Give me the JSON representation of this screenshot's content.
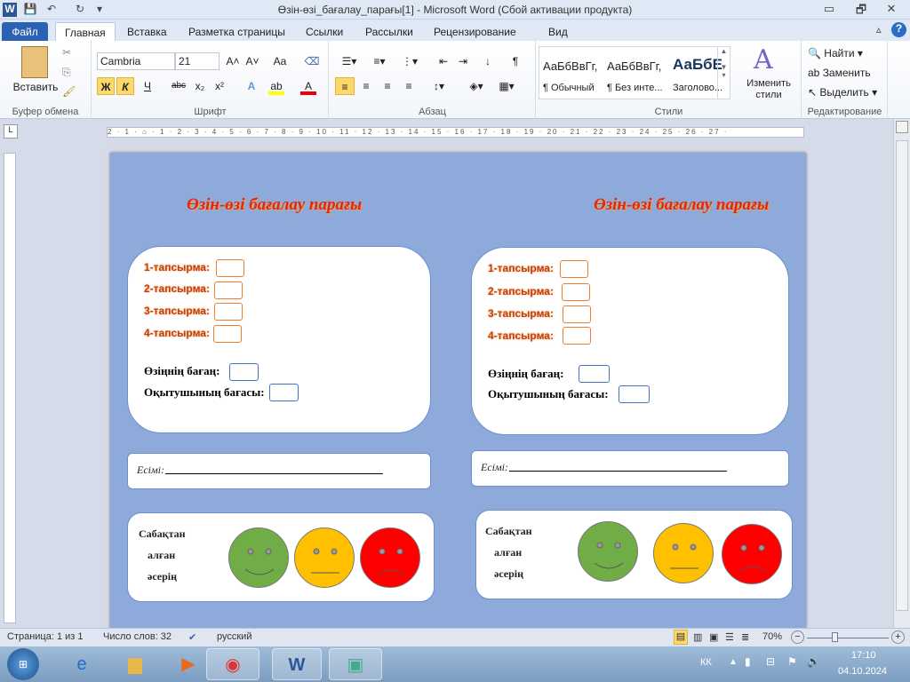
{
  "window": {
    "title": "Өзін-өзі_бағалау_парағы[1] - Microsoft Word (Сбой активации продукта)",
    "minimize": "▭",
    "restore": "🗗",
    "close": "✕"
  },
  "quick_access": {
    "save": "💾",
    "undo": "↶",
    "redo": "↻",
    "customize": "▾"
  },
  "tabs": [
    "Файл",
    "Главная",
    "Вставка",
    "Разметка страницы",
    "Ссылки",
    "Рассылки",
    "Рецензирование",
    "Вид"
  ],
  "ribbon": {
    "clipboard": {
      "label": "Буфер обмена",
      "paste": "Вставить"
    },
    "font": {
      "label": "Шрифт",
      "name": "Cambria",
      "size": "21",
      "bold": "Ж",
      "italic": "К",
      "underline": "Ч",
      "strike": "abc",
      "sub": "x₂",
      "sup": "x²",
      "grow": "A˄",
      "shrink": "A˅",
      "case": "Aa"
    },
    "paragraph": {
      "label": "Абзац",
      "pilcrow": "¶"
    },
    "styles": {
      "label": "Стили",
      "items": [
        {
          "preview": "АаБбВвГг,",
          "name": "¶ Обычный"
        },
        {
          "preview": "АаБбВвГг,",
          "name": "¶ Без инте..."
        },
        {
          "preview": "АаБбЕ",
          "name": "Заголово..."
        }
      ],
      "change": "Изменить стили"
    },
    "editing": {
      "label": "Редактирование",
      "find": "Найти",
      "replace": "Заменить",
      "select": "Выделить"
    }
  },
  "ruler": "2 · 1 · ⌂ · 1 · 2 · 3 · 4 · 5 · 6 · 7 · 8 · 9 · 10 · 11 · 12 · 13 · 14 · 15 · 16 · 17 · 18 · 19 · 20 · 21 · 22 · 23 · 24 · 25 · 26 · 27 ·",
  "document": {
    "columns": [
      {
        "title": "Өзін-өзі бағалау парағы",
        "tasks": [
          "1-тапсырма:",
          "2-тапсырма:",
          "3-тапсырма:",
          "4-тапсырма:"
        ],
        "self_grade": "Өзіңнің бағаң:",
        "teacher_grade": "Оқытушының бағасы:",
        "name_label": "Есімі:",
        "reaction": [
          "Сабақтан",
          "алған",
          "әсерің"
        ]
      },
      {
        "title": "Өзін-өзі бағалау парағы",
        "tasks": [
          "1-тапсырма:",
          "2-тапсырма:",
          "3-тапсырма:",
          "4-тапсырма:"
        ],
        "self_grade": "Өзіңнің бағаң:",
        "teacher_grade": "Оқытушының бағасы:",
        "name_label": "Есімі:",
        "reaction": [
          "Сабақтан",
          "алған",
          "әсерің"
        ]
      }
    ],
    "face_colors": {
      "happy": "#70ad47",
      "neutral": "#ffc000",
      "sad": "#ff0000"
    }
  },
  "status": {
    "page": "Страница: 1 из 1",
    "words": "Число слов: 32",
    "language": "русский",
    "zoom": "70%",
    "zoom_value": 70
  },
  "taskbar": {
    "lang": "КК",
    "time": "17:10",
    "date": "04.10.2024"
  }
}
